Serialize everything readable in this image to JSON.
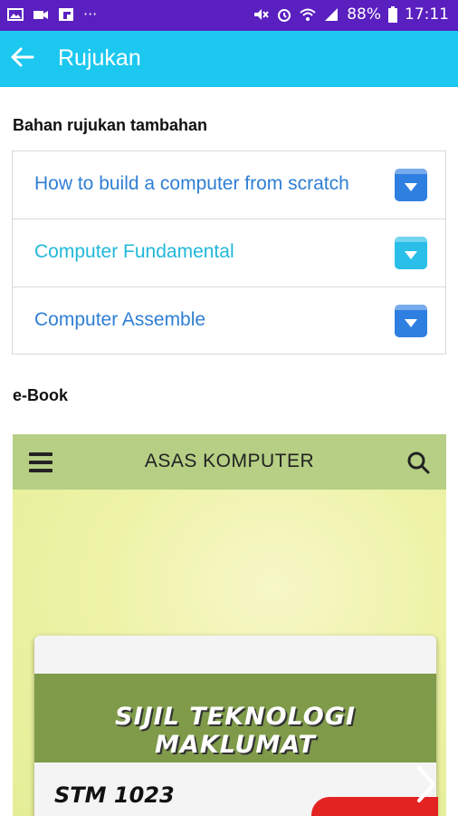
{
  "status_bar": {
    "battery": "88%",
    "time": "17:11",
    "left_icons": [
      "image-icon",
      "video-icon",
      "flipboard-icon",
      "more-icon"
    ],
    "right_icons": [
      "mute-icon",
      "alarm-icon",
      "wifi-icon",
      "signal-icon",
      "battery-icon"
    ],
    "color": "#5a1fbf"
  },
  "app_bar": {
    "title": "Rujukan",
    "color": "#1dc8f0"
  },
  "references": {
    "heading": "Bahan rujukan tambahan",
    "items": [
      {
        "label": "How to build a computer from scratch",
        "color": "#2f7fd3",
        "icon": "download-icon"
      },
      {
        "label": "Computer Fundamental",
        "color": "#21b8d8",
        "icon": "download-icon"
      },
      {
        "label": "Computer Assemble",
        "color": "#2f7fd3",
        "icon": "download-icon"
      }
    ]
  },
  "ebook": {
    "heading": "e-Book",
    "viewer_title": "ASAS KOMPUTER",
    "cover_title": "SIJIL TEKNOLOGI MAKLUMAT",
    "cover_code": "STM 1023"
  }
}
